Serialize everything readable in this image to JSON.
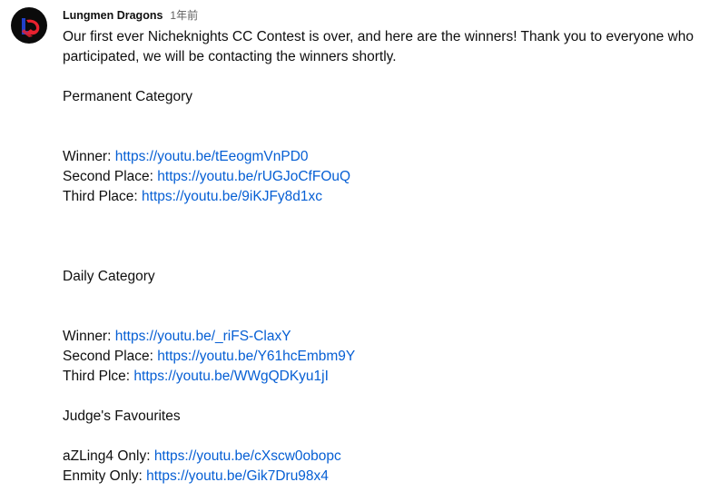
{
  "comment": {
    "author": "Lungmen Dragons",
    "timestamp": "1年前",
    "intro_line1": "Our first ever Nicheknights CC Contest is over, and here are the winners! Thank you to everyone who",
    "intro_line2": "participated, we will be contacting the winners shortly.",
    "sections": [
      {
        "title": "Permanent Category",
        "entries": [
          {
            "label": "Winner:",
            "link": "https://youtu.be/tEeogmVnPD0"
          },
          {
            "label": "Second Place:",
            "link": "https://youtu.be/rUGJoCfFOuQ"
          },
          {
            "label": "Third Place:",
            "link": "https://youtu.be/9iKJFy8d1xc"
          }
        ]
      },
      {
        "title": "Daily Category",
        "entries": [
          {
            "label": "Winner:",
            "link": "https://youtu.be/_riFS-ClaxY"
          },
          {
            "label": "Second Place:",
            "link": "https://youtu.be/Y61hcEmbm9Y"
          },
          {
            "label": "Third Plce:",
            "link": "https://youtu.be/WWgQDKyu1jI"
          }
        ]
      },
      {
        "title": "Judge's Favourites",
        "entries": [
          {
            "label": "aZLing4 Only:",
            "link": "https://youtu.be/cXscw0obopc"
          },
          {
            "label": "Enmity Only:",
            "link": "https://youtu.be/Gik7Dru98x4"
          }
        ]
      }
    ]
  },
  "avatar": {
    "icon": "lungmen-dragons-logo-icon",
    "background": "#0b0b0b",
    "accent_red": "#e8212e",
    "accent_blue": "#2140c8"
  },
  "colors": {
    "text": "#0f0f0f",
    "meta": "#606060",
    "link": "#065fd4"
  }
}
